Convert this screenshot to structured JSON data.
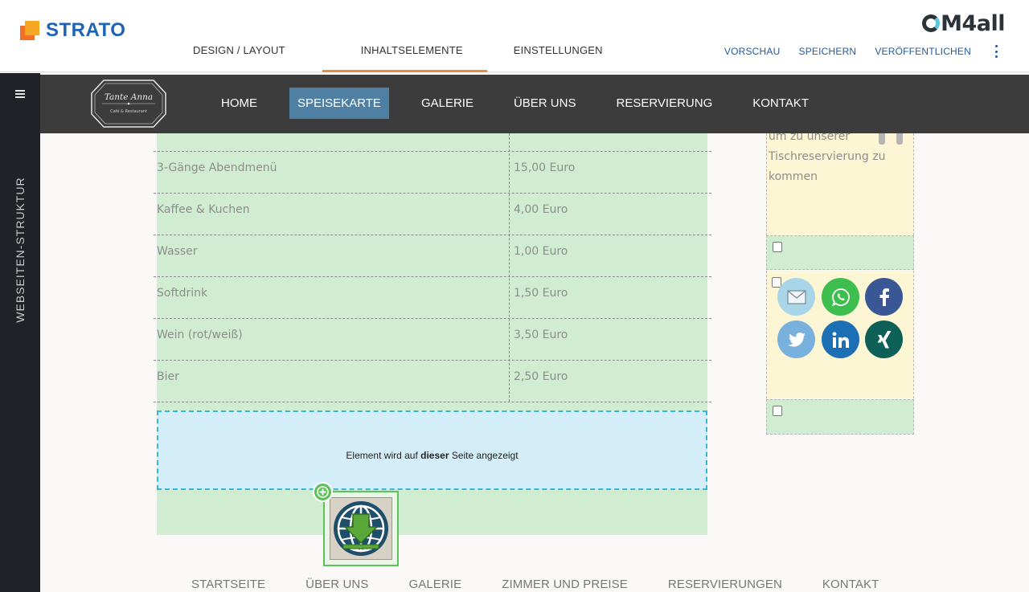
{
  "editor": {
    "brand": "STRATO",
    "product_logo": "M4all",
    "tabs": [
      {
        "label": "DESIGN / LAYOUT"
      },
      {
        "label": "INHALTSELEMENTE"
      },
      {
        "label": "EINSTELLUNGEN"
      }
    ],
    "active_tab": "INHALTSELEMENTE",
    "actions": [
      {
        "label": "VORSCHAU"
      },
      {
        "label": "SPEICHERN"
      },
      {
        "label": "VERÖFFENTLICHEN"
      }
    ],
    "side_label": "WEBSEITEN-STRUKTUR",
    "accent_color": "#ef8a3b",
    "link_color": "#1f5a9e"
  },
  "site": {
    "logo": {
      "title": "Tante Anna",
      "subtitle": "Café & Restaurant"
    },
    "nav": [
      {
        "label": "HOME"
      },
      {
        "label": "SPEISEKARTE"
      },
      {
        "label": "GALERIE"
      },
      {
        "label": "ÜBER UNS"
      },
      {
        "label": "RESERVIERUNG"
      },
      {
        "label": "KONTAKT"
      }
    ],
    "active_nav": "SPEISEKARTE",
    "nav_active_color": "#4f7fa3",
    "menu_rows": [
      {
        "name": "3-Gänge Abendmenü",
        "price": "15,00 Euro"
      },
      {
        "name": "Kaffee & Kuchen",
        "price": "4,00 Euro"
      },
      {
        "name": "Wasser",
        "price": "1,00 Euro"
      },
      {
        "name": "Softdrink",
        "price": "1,50 Euro"
      },
      {
        "name": "Wein (rot/weiß)",
        "price": "3,50 Euro"
      },
      {
        "name": "Bier",
        "price": "2,50 Euro"
      }
    ],
    "dropzone": {
      "prefix": "Element wird auf ",
      "bold": "dieser",
      "suffix": " Seite angezeigt"
    },
    "sidebar_text": "um zu unserer Tischreservierung zu kommen",
    "social": [
      "mail-icon",
      "whatsapp-icon",
      "facebook-icon",
      "twitter-icon",
      "linkedin-icon",
      "xing-icon"
    ],
    "footer_nav": [
      {
        "label": "STARTSEITE"
      },
      {
        "label": "ÜBER UNS"
      },
      {
        "label": "GALERIE"
      },
      {
        "label": "ZIMMER UND PREISE"
      },
      {
        "label": "RESERVIERUNGEN"
      },
      {
        "label": "KONTAKT"
      }
    ]
  }
}
